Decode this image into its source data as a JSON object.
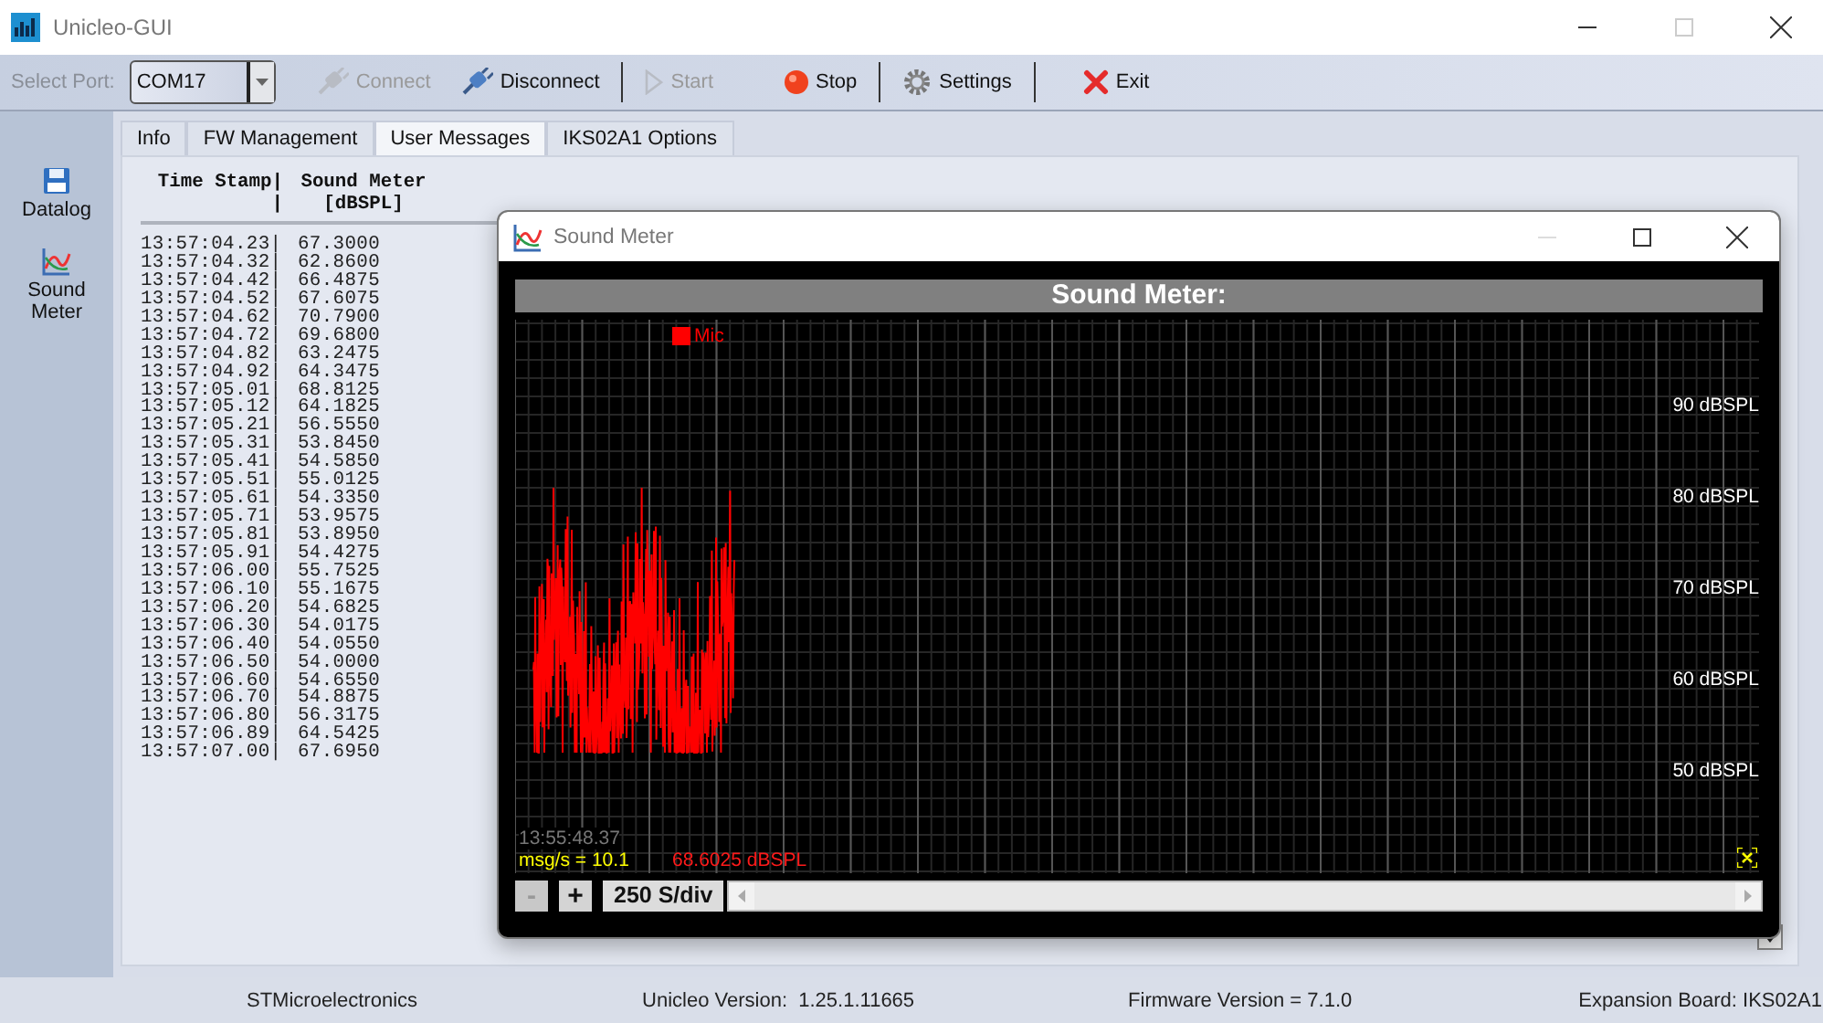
{
  "window": {
    "title": "Unicleo-GUI"
  },
  "toolbar": {
    "port_label": "Select Port:",
    "port": "COM17",
    "buttons": [
      {
        "kind": "connect",
        "label": "Connect",
        "disabled": true
      },
      {
        "kind": "disconnect",
        "label": "Disconnect",
        "disabled": false
      },
      {
        "kind": "start",
        "label": "Start",
        "disabled": true
      },
      {
        "kind": "stop",
        "label": "Stop",
        "disabled": false
      },
      {
        "kind": "settings",
        "label": "Settings",
        "disabled": false
      },
      {
        "kind": "exit",
        "label": "Exit",
        "disabled": false
      }
    ]
  },
  "sidebar": {
    "items": [
      {
        "kind": "datalog",
        "label": "Datalog"
      },
      {
        "kind": "chart",
        "label": "Sound Meter"
      }
    ]
  },
  "tabs": [
    {
      "label": "Info",
      "selected": false
    },
    {
      "label": "FW Management",
      "selected": false
    },
    {
      "label": "User Messages",
      "selected": true
    },
    {
      "label": "IKS02A1 Options",
      "selected": false
    }
  ],
  "log": {
    "columns": [
      {
        "lines": [
          "Time Stamp|",
          "|"
        ]
      },
      {
        "lines": [
          "Sound Meter",
          "[dBSPL]"
        ]
      }
    ],
    "rows": [
      [
        "13:57:04.23|",
        "67.3000"
      ],
      [
        "13:57:04.32|",
        "62.8600"
      ],
      [
        "13:57:04.42|",
        "66.4875"
      ],
      [
        "13:57:04.52|",
        "67.6075"
      ],
      [
        "13:57:04.62|",
        "70.7900"
      ],
      [
        "13:57:04.72|",
        "69.6800"
      ],
      [
        "13:57:04.82|",
        "63.2475"
      ],
      [
        "13:57:04.92|",
        "64.3475"
      ],
      [
        "13:57:05.01|",
        "68.8125"
      ],
      [
        "13:57:05.12|",
        "64.1825"
      ],
      [
        "13:57:05.21|",
        "56.5550"
      ],
      [
        "13:57:05.31|",
        "53.8450"
      ],
      [
        "13:57:05.41|",
        "54.5850"
      ],
      [
        "13:57:05.51|",
        "55.0125"
      ],
      [
        "13:57:05.61|",
        "54.3350"
      ],
      [
        "13:57:05.71|",
        "53.9575"
      ],
      [
        "13:57:05.81|",
        "53.8950"
      ],
      [
        "13:57:05.91|",
        "54.4275"
      ],
      [
        "13:57:06.00|",
        "55.7525"
      ],
      [
        "13:57:06.10|",
        "55.1675"
      ],
      [
        "13:57:06.20|",
        "54.6825"
      ],
      [
        "13:57:06.30|",
        "54.0175"
      ],
      [
        "13:57:06.40|",
        "54.0550"
      ],
      [
        "13:57:06.50|",
        "54.0000"
      ],
      [
        "13:57:06.60|",
        "54.6550"
      ],
      [
        "13:57:06.70|",
        "54.8875"
      ],
      [
        "13:57:06.80|",
        "56.3175"
      ],
      [
        "13:57:06.89|",
        "64.5425"
      ],
      [
        "13:57:07.00|",
        "67.6950"
      ]
    ]
  },
  "sound_meter": {
    "title": "Sound Meter",
    "header": "Sound Meter:",
    "legend": {
      "label": "Mic",
      "color": "#ff0000"
    },
    "y_labels": [
      "90 dBSPL",
      "80 dBSPL",
      "70 dBSPL",
      "60 dBSPL",
      "50 dBSPL"
    ],
    "timestamp": "13:55:48.37",
    "rate": "msg/s = 10.1",
    "reading": "68.6025 dBSPL",
    "zoom_buttons": [
      {
        "label": "-",
        "disabled": true
      },
      {
        "label": "+",
        "disabled": false
      }
    ],
    "scale": "250 S/div"
  },
  "status_bar": [
    "STMicroelectronics",
    "Unicleo Version:  1.25.1.11665",
    "Firmware Version = 7.1.0",
    "Expansion Board: IKS02A1"
  ]
}
